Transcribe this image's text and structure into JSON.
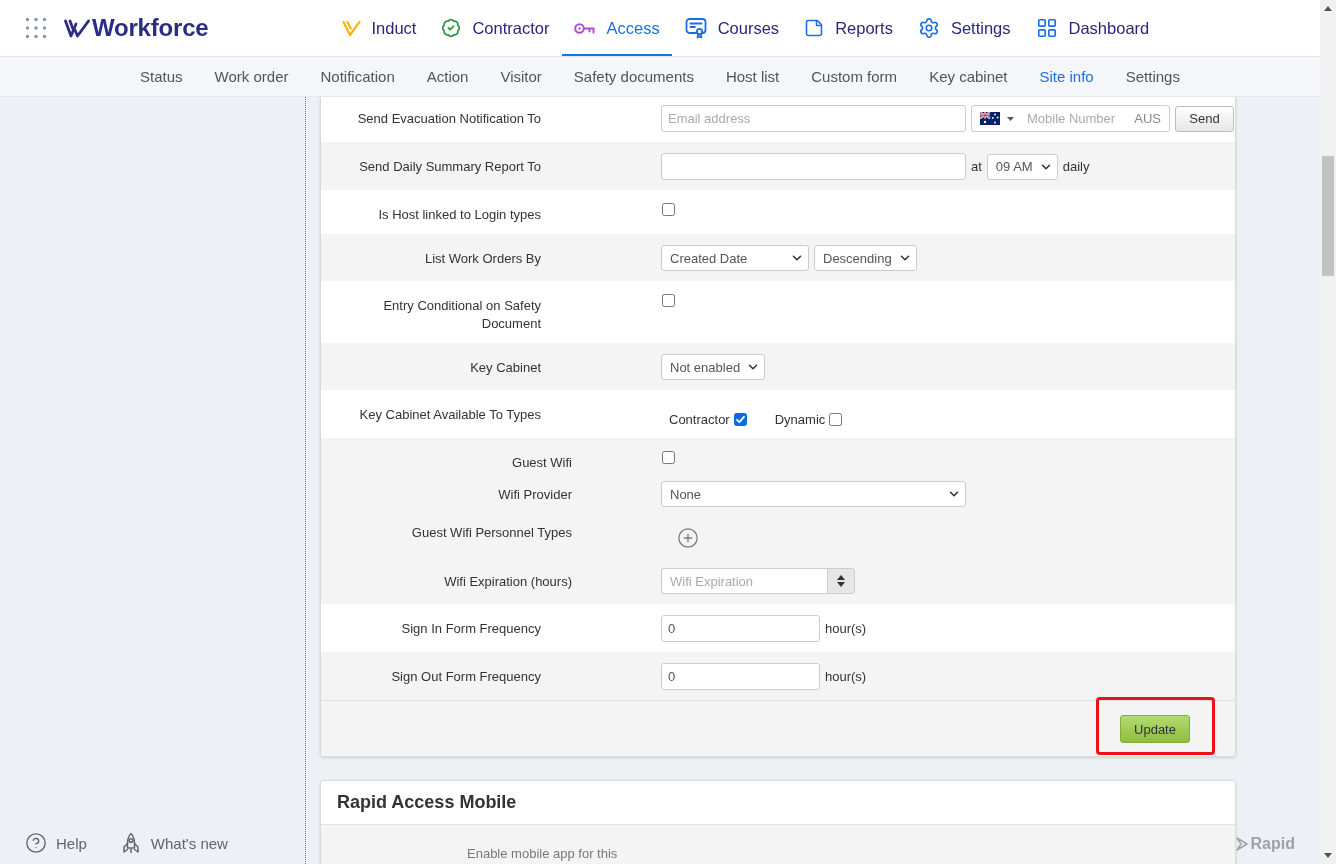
{
  "header": {
    "logo": "Workforce"
  },
  "main_nav": [
    {
      "label": "Induct",
      "selected": false
    },
    {
      "label": "Contractor",
      "selected": false
    },
    {
      "label": "Access",
      "selected": true
    },
    {
      "label": "Courses",
      "selected": false
    },
    {
      "label": "Reports",
      "selected": false
    },
    {
      "label": "Settings",
      "selected": false
    },
    {
      "label": "Dashboard",
      "selected": false
    }
  ],
  "sub_nav": [
    {
      "label": "Status",
      "selected": false
    },
    {
      "label": "Work order",
      "selected": false
    },
    {
      "label": "Notification",
      "selected": false
    },
    {
      "label": "Action",
      "selected": false
    },
    {
      "label": "Visitor",
      "selected": false
    },
    {
      "label": "Safety documents",
      "selected": false
    },
    {
      "label": "Host list",
      "selected": false
    },
    {
      "label": "Custom form",
      "selected": false
    },
    {
      "label": "Key cabinet",
      "selected": false
    },
    {
      "label": "Site info",
      "selected": true
    },
    {
      "label": "Settings",
      "selected": false
    }
  ],
  "form": {
    "rows": [
      {
        "kind": "contact",
        "label": "Send Evacuation Notification To",
        "email_placeholder": "Email address",
        "phone_placeholder": "Mobile Number",
        "country": "AUS",
        "button": "Send"
      },
      {
        "kind": "report",
        "label": "Send Daily Summary Report To",
        "connector": "at",
        "time": "09 AM",
        "suffix": "daily"
      },
      {
        "kind": "checkbox",
        "label": "Is Host linked to Login types",
        "checked": false
      },
      {
        "kind": "selects",
        "label": "List Work Orders By",
        "selects": [
          "Created Date",
          "Descending"
        ]
      },
      {
        "kind": "checkbox",
        "label": "Entry Conditional on Safety Document",
        "checked": false
      },
      {
        "kind": "selects",
        "label": "Key Cabinet",
        "selects": [
          "Not enabled"
        ]
      },
      {
        "kind": "options",
        "label": "Key Cabinet Available To Types",
        "options": [
          {
            "label": "Contractor",
            "checked": true
          },
          {
            "label": "Dynamic",
            "checked": false
          }
        ]
      },
      {
        "kind": "group",
        "items": [
          {
            "kind": "checkbox",
            "label": "Guest Wifi",
            "checked": false
          },
          {
            "kind": "select",
            "label": "Wifi Provider",
            "value": "None"
          },
          {
            "kind": "add",
            "label": "Guest Wifi Personnel Types"
          },
          {
            "kind": "number",
            "label": "Wifi Expiration (hours)",
            "placeholder": "Wifi Expiration"
          }
        ]
      },
      {
        "kind": "hours",
        "label": "Sign In Form Frequency",
        "value": "0",
        "unit": "hour(s)"
      },
      {
        "kind": "hours",
        "label": "Sign Out Form Frequency",
        "value": "0",
        "unit": "hour(s)"
      }
    ],
    "footer": {
      "button": "Update",
      "highlighted": true
    }
  },
  "mobile_card": {
    "title": "Rapid Access Mobile",
    "text": "Enable mobile app for this"
  },
  "footer": {
    "links": [
      "Help",
      "What's new"
    ],
    "brand": "Rapid"
  }
}
